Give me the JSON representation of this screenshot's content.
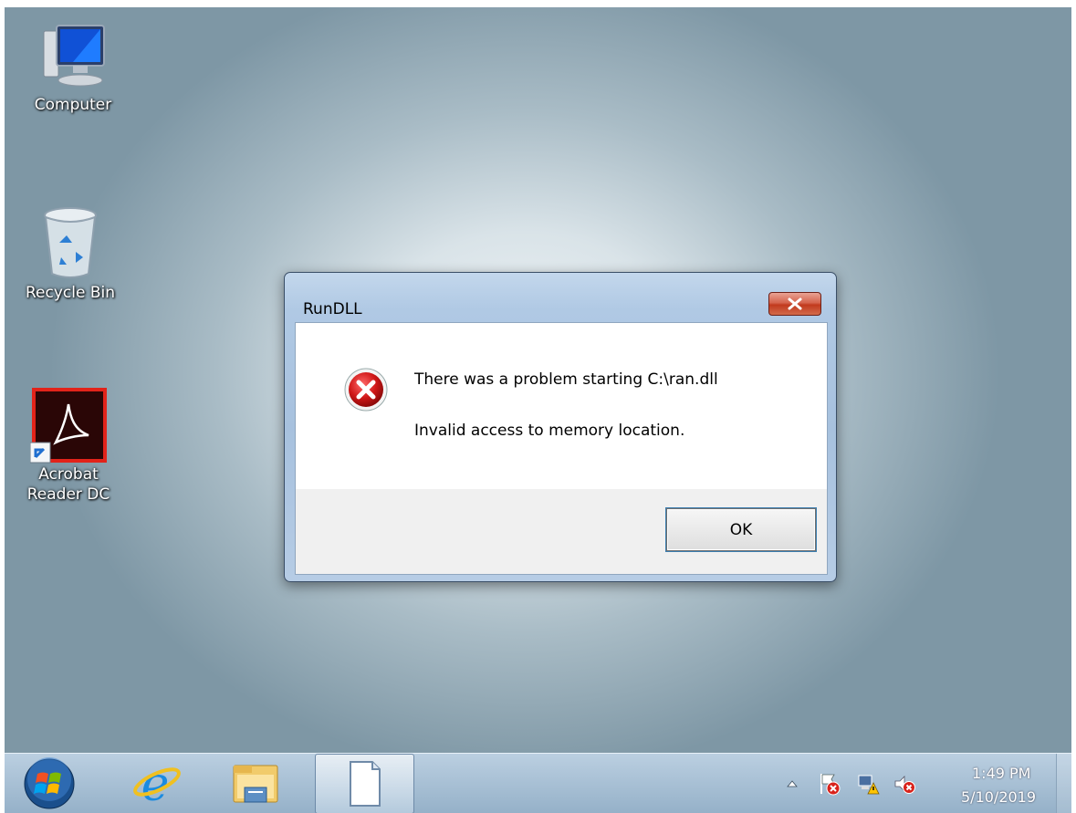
{
  "desktop": {
    "icons": [
      {
        "label": "Computer",
        "icon": "computer-icon"
      },
      {
        "label": "Recycle Bin",
        "icon": "recycle-bin-icon"
      },
      {
        "label_line1": "Acrobat",
        "label_line2": "Reader DC",
        "icon": "acrobat-reader-icon"
      }
    ]
  },
  "dialog": {
    "title": "RunDLL",
    "message": "There was a problem starting C:\\ran.dll",
    "detail": "Invalid access to memory location.",
    "ok_label": "OK",
    "icon": "error-icon"
  },
  "taskbar": {
    "pinned": [
      "start-orb-icon",
      "internet-explorer-icon",
      "windows-explorer-icon",
      "blank-document-icon"
    ],
    "tray_icons": [
      "show-hidden-icons",
      "action-center-flag-icon",
      "network-warning-icon",
      "volume-muted-icon"
    ],
    "time": "1:49 PM",
    "date": "5/10/2019"
  },
  "colors": {
    "close_button": "#c13a1e",
    "dialog_frame": "#a7c1de",
    "error_red": "#c8102e"
  }
}
